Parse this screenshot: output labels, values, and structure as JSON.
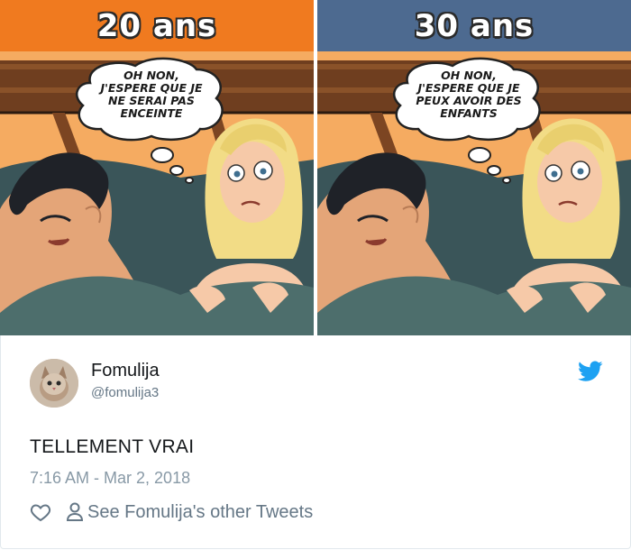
{
  "comic": {
    "left_panel": {
      "age_label": "20 ans",
      "thought_lines": [
        "OH NON,",
        "J'ESPERE QUE JE",
        "NE SERAI PAS",
        "ENCEINTE"
      ],
      "header_color": "#f07a1f"
    },
    "right_panel": {
      "age_label": "30 ans",
      "thought_lines": [
        "OH NON,",
        "J'ESPERE QUE JE",
        "PEUX AVOIR DES",
        "ENFANTS"
      ],
      "header_color": "#4d6a90"
    }
  },
  "tweet": {
    "display_name": "Fomulija",
    "handle": "@fomulija3",
    "text": "TELLEMENT VRAI",
    "timestamp": "7:16 AM - Mar 2, 2018",
    "see_other_tweets": "See Fomulija's other Tweets",
    "icons": {
      "brand": "twitter-bird-icon",
      "like": "heart-icon",
      "profile": "person-icon"
    },
    "colors": {
      "brand": "#1da1f2",
      "muted": "#657786"
    }
  }
}
